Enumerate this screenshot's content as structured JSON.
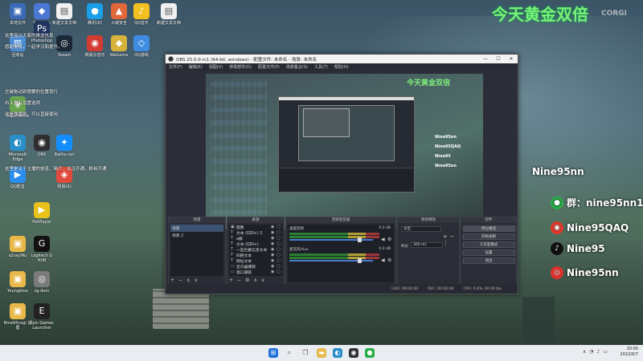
{
  "wallpaper": {
    "banner": "今天黄金双倍",
    "corgi_text": "CORGI",
    "socials": [
      {
        "name": "weibo-handle",
        "text": "Nine95nn",
        "icon": "",
        "color": ""
      },
      {
        "name": "wechat",
        "text": "群：nine95nn1",
        "icon": "●",
        "color": "#2aae4a"
      },
      {
        "name": "weibo",
        "text": "Nine95QAQ",
        "icon": "◉",
        "color": "#e33a2c"
      },
      {
        "name": "tiktok",
        "text": "Nine95",
        "icon": "♪",
        "color": "#111111"
      },
      {
        "name": "netease",
        "text": "Nine95nn",
        "icon": "◎",
        "color": "#e5322d"
      }
    ]
  },
  "desktop": {
    "icons": [
      {
        "label": "本地文件",
        "glyph": "▣",
        "color": "#3b6bb8"
      },
      {
        "label": "Nordvpn",
        "glyph": "◆",
        "color": "#4a77d4"
      },
      {
        "label": "新建文本文档",
        "glyph": "▤",
        "color": "#f0f0f0"
      },
      {
        "label": "腾讯QQ",
        "glyph": "●",
        "color": "#1b9fe8"
      },
      {
        "label": "火绒安全",
        "glyph": "▲",
        "color": "#e0683a"
      },
      {
        "label": "QQ音乐",
        "glyph": "♪",
        "color": "#f2c021"
      },
      {
        "label": "新建文本文档",
        "glyph": "▤",
        "color": "#f0f0f0"
      },
      {
        "label": "回收站",
        "glyph": "▥",
        "color": "#4c8fd6"
      },
      {
        "label": "Steam",
        "glyph": "◎",
        "color": "#1b2838"
      },
      {
        "label": "网易云音乐",
        "glyph": "◉",
        "color": "#d33a31"
      },
      {
        "label": "WeGame",
        "glyph": "◆",
        "color": "#d8b33c"
      },
      {
        "label": "QQ游戏",
        "glyph": "◇",
        "color": "#3e8de0"
      },
      {
        "label": "Photoshop",
        "glyph": "Ps",
        "color": "#21345e"
      },
      {
        "label": "Experience",
        "glyph": "◈",
        "color": "#6aa84f"
      },
      {
        "label": "Microsoft Edge",
        "glyph": "◐",
        "color": "#2a8ec8"
      },
      {
        "label": "OBS",
        "glyph": "◉",
        "color": "#302e31"
      },
      {
        "label": "Battle.net",
        "glyph": "✦",
        "color": "#148eff"
      },
      {
        "label": "QQ影音",
        "glyph": "▶",
        "color": "#2b8df0"
      },
      {
        "label": "网易UU",
        "glyph": "◈",
        "color": "#e14a3c"
      },
      {
        "label": "PotPlayer",
        "glyph": "▶",
        "color": "#e8c21b"
      },
      {
        "label": "Logitech G HUB",
        "glyph": "G",
        "color": "#111111"
      },
      {
        "label": "s2ray/Nu",
        "glyph": "▣",
        "color": "#e8b84a"
      },
      {
        "label": "Youngbloo",
        "glyph": "▣",
        "color": "#e8b84a"
      },
      {
        "label": "zg.dem",
        "glyph": "◎",
        "color": "#7a7a7a"
      },
      {
        "label": "Nine95cogi 设置",
        "glyph": "▣",
        "color": "#e8b84a"
      },
      {
        "label": "Epic Games Launcher",
        "glyph": "E",
        "color": "#222222"
      }
    ],
    "notes": [
      "这里显示大家的推送信息",
      "感谢支持，一起学习和提升。",
      "左键拖动到想要的位置就行",
      "右上角有设置选项",
      "这是弹幕姬，可以直接使用",
      "这里是关于主播的信息、简介、关注开通，粉丝开通"
    ]
  },
  "obs": {
    "title": "OBS 25.0.0-rc1 (64-bit, windows) - 配置文件: 未命名 - 场景: 未命名",
    "menu": [
      "文件(F)",
      "编辑(E)",
      "视图(V)",
      "停靠部件(D)",
      "配置文件(P)",
      "场景集合(S)",
      "工具(T)",
      "帮助(H)"
    ],
    "preview_banner": "今天黄金双倍",
    "preview_socials": [
      "Nine95nn",
      "Nine95QAQ",
      "Nine95",
      "Nine95nn"
    ],
    "docks": {
      "scenes": {
        "title": "场景",
        "items": [
          "场景",
          "场景 2"
        ],
        "selected": 0
      },
      "sources": {
        "title": "来源",
        "items": [
          {
            "label": "图像",
            "icon": "▣"
          },
          {
            "label": "文本 (GDI+) 3",
            "icon": "T"
          },
          {
            "label": "a群",
            "icon": "T"
          },
          {
            "label": "文本 (GDI+)",
            "icon": "T"
          },
          {
            "label": "一些社群信息文本",
            "icon": "T"
          },
          {
            "label": "四链文本",
            "icon": "T"
          },
          {
            "label": "网址文本",
            "icon": "T"
          },
          {
            "label": "显示器捕获",
            "icon": "▭"
          },
          {
            "label": "窗口捕获",
            "icon": "▭"
          }
        ]
      },
      "mixer": {
        "title": "音频混音器",
        "channels": [
          {
            "label": "桌面音频",
            "db": "0.0 dB",
            "level": 0.82
          },
          {
            "label": "麦克风/Aux",
            "db": "0.0 dB",
            "level": 0.82
          }
        ]
      },
      "transitions": {
        "title": "转场特效",
        "type": "淡出",
        "duration_label": "时长",
        "duration": "300 ms"
      },
      "controls": {
        "title": "控件",
        "buttons": [
          "停止推流",
          "开始录制",
          "工作室模式",
          "设置",
          "退出"
        ]
      }
    },
    "status": {
      "live": "LIVE: 00:00:00",
      "rec": "REC: 00:00:00",
      "cpu": "CPU: 0.4%, 60.00 fps"
    }
  },
  "taskbar": {
    "apps": [
      {
        "name": "start",
        "glyph": "⊞",
        "color": "#1e6fd9"
      },
      {
        "name": "search",
        "glyph": "⌕",
        "color": "#555555"
      },
      {
        "name": "task-view",
        "glyph": "❐",
        "color": "#555555"
      },
      {
        "name": "file-explorer",
        "glyph": "▬",
        "color": "#e8b84a"
      },
      {
        "name": "edge",
        "glyph": "◐",
        "color": "#2a8ec8"
      },
      {
        "name": "obs",
        "glyph": "◉",
        "color": "#302e31"
      },
      {
        "name": "wechat",
        "glyph": "●",
        "color": "#2aae4a"
      }
    ],
    "time": "20:00",
    "date": "2022/6/7"
  }
}
